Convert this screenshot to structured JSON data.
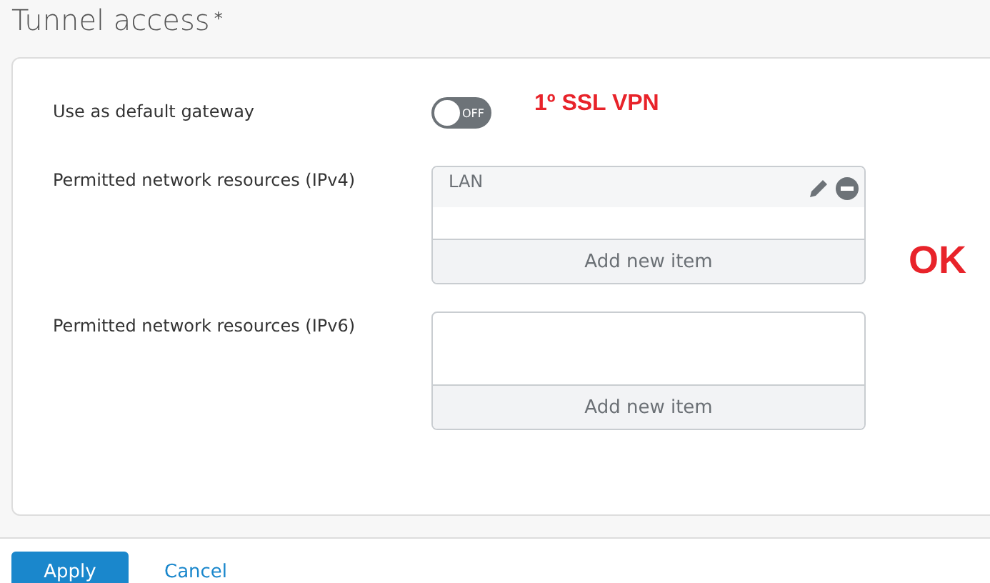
{
  "section": {
    "title": "Tunnel access",
    "required_mark": "*"
  },
  "settings": [
    {
      "kind": "toggle",
      "label": "Use as default gateway",
      "on": false,
      "toggle_text": "OFF"
    },
    {
      "kind": "list",
      "label": "Permitted network resources (IPv4)",
      "items": [
        {
          "label": "LAN"
        }
      ],
      "add_label": "Add new item"
    },
    {
      "kind": "list",
      "label": "Permitted network resources (IPv6)",
      "add_label": "Add new item"
    }
  ],
  "annotations": [
    {
      "text": "1º SSL VPN"
    },
    {
      "text": "OK"
    }
  ],
  "buttons": {
    "apply": "Apply",
    "cancel": "Cancel"
  }
}
